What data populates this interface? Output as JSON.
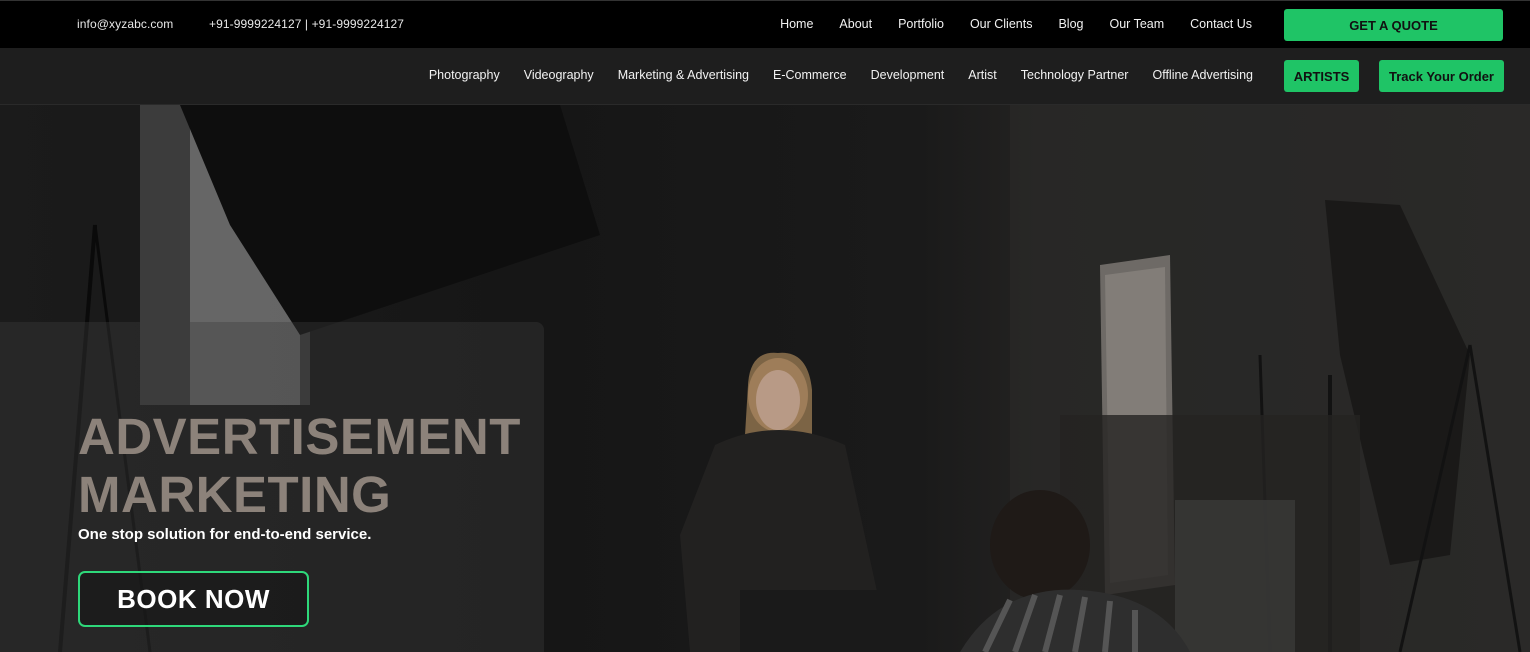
{
  "topbar": {
    "email": "info@xyzabc.com",
    "phones": "+91-9999224127 | +91-9999224127",
    "nav": [
      "Home",
      "About",
      "Portfolio",
      "Our Clients",
      "Blog",
      "Our Team",
      "Contact Us"
    ],
    "quote_label": "GET A QUOTE"
  },
  "subnav": {
    "items": [
      "Photography",
      "Videography",
      "Marketing & Advertising",
      "E-Commerce",
      "Development",
      "Artist",
      "Technology Partner",
      "Offline Advertising"
    ],
    "artists_label": "ARTISTS",
    "track_label": "Track Your Order"
  },
  "hero": {
    "title_line1": "ADVERTISEMENT",
    "title_line2": "MARKETING",
    "subtitle": "One stop solution for end-to-end service.",
    "cta_label": "BOOK NOW"
  },
  "colors": {
    "accent": "#1fc466",
    "topbar_bg": "#000000",
    "subbar_bg": "#1e1e1e",
    "title_color": "#8c827a"
  }
}
